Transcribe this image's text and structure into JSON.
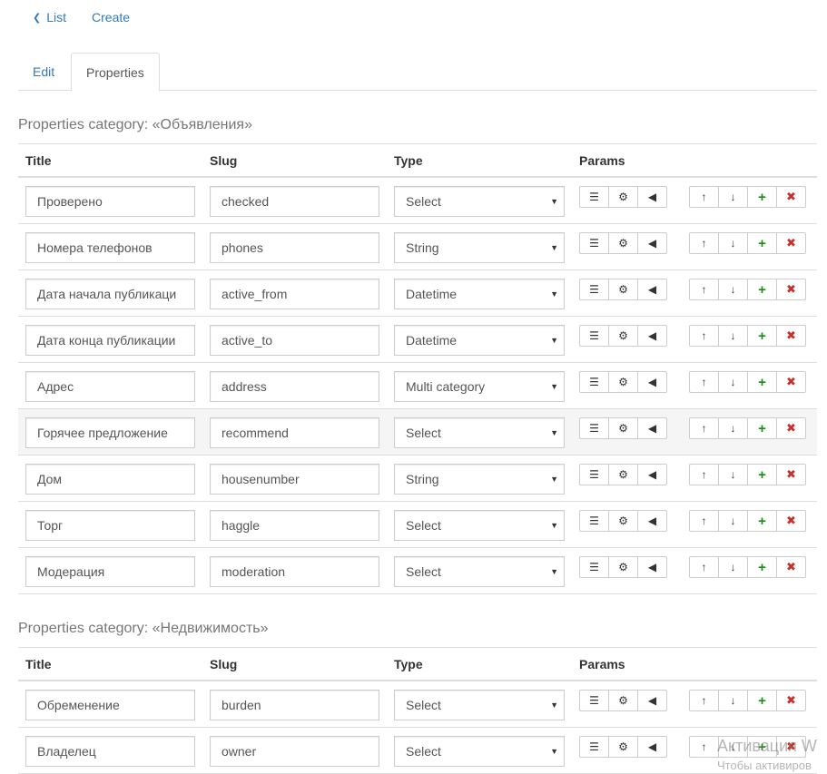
{
  "nav": {
    "list_label": "List",
    "create_label": "Create"
  },
  "tabs": [
    {
      "label": "Edit"
    },
    {
      "label": "Properties"
    }
  ],
  "columns": {
    "title": "Title",
    "slug": "Slug",
    "type": "Type",
    "params": "Params"
  },
  "categories": [
    {
      "title": "Properties category: «Объявления»",
      "rows": [
        {
          "title": "Проверено",
          "slug": "checked",
          "type": "Select"
        },
        {
          "title": "Номера телефонов",
          "slug": "phones",
          "type": "String"
        },
        {
          "title": "Дата начала публикаци",
          "slug": "active_from",
          "type": "Datetime"
        },
        {
          "title": "Дата конца публикации",
          "slug": "active_to",
          "type": "Datetime"
        },
        {
          "title": "Адрес",
          "slug": "address",
          "type": "Multi category"
        },
        {
          "title": "Горячее предложение",
          "slug": "recommend",
          "type": "Select"
        },
        {
          "title": "Дом",
          "slug": "housenumber",
          "type": "String"
        },
        {
          "title": "Торг",
          "slug": "haggle",
          "type": "Select"
        },
        {
          "title": "Модерация",
          "slug": "moderation",
          "type": "Select"
        }
      ]
    },
    {
      "title": "Properties category: «Недвижимость»",
      "rows": [
        {
          "title": "Обременение",
          "slug": "burden",
          "type": "Select"
        },
        {
          "title": "Владелец",
          "slug": "owner",
          "type": "Select"
        }
      ]
    }
  ],
  "icons": {
    "chevron": "chevron-left-icon",
    "list": "list-icon",
    "gear": "gear-icon",
    "bullhorn": "bullhorn-icon",
    "up": "arrow-up-icon",
    "down": "arrow-down-icon",
    "plus": "plus-icon",
    "remove": "remove-icon"
  },
  "colors": {
    "link": "#337ab7",
    "plus": "#1a8c1a",
    "remove": "#c9302c"
  },
  "watermark": {
    "line1": "Активация W",
    "line2": "Чтобы активиров"
  }
}
